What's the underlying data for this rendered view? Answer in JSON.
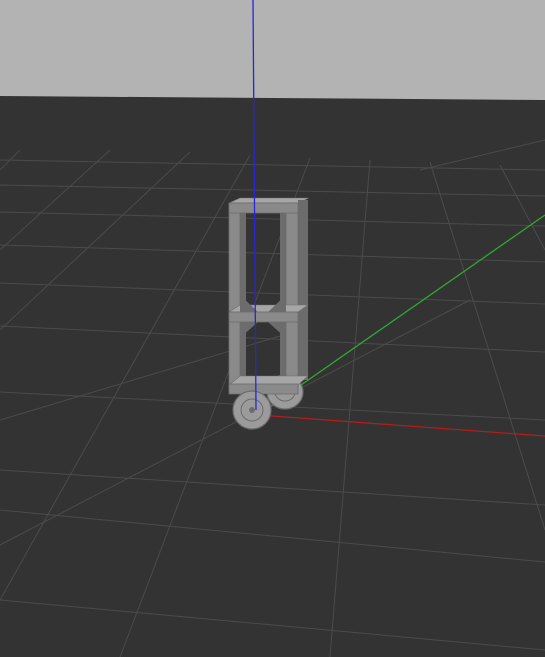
{
  "viewport": {
    "sky_color": "#b3b3b3",
    "ground_color": "#333333",
    "grid_color": "#4b4b4b"
  },
  "axes": {
    "x_color": "#b21d1d",
    "y_color": "#2fa82f",
    "z_color": "#2626d9"
  },
  "robot": {
    "frame_color": "#8a8a8a",
    "frame_dark": "#6c6c6c",
    "frame_light": "#a6a6a6",
    "wheel_color": "#9b9b9b"
  }
}
